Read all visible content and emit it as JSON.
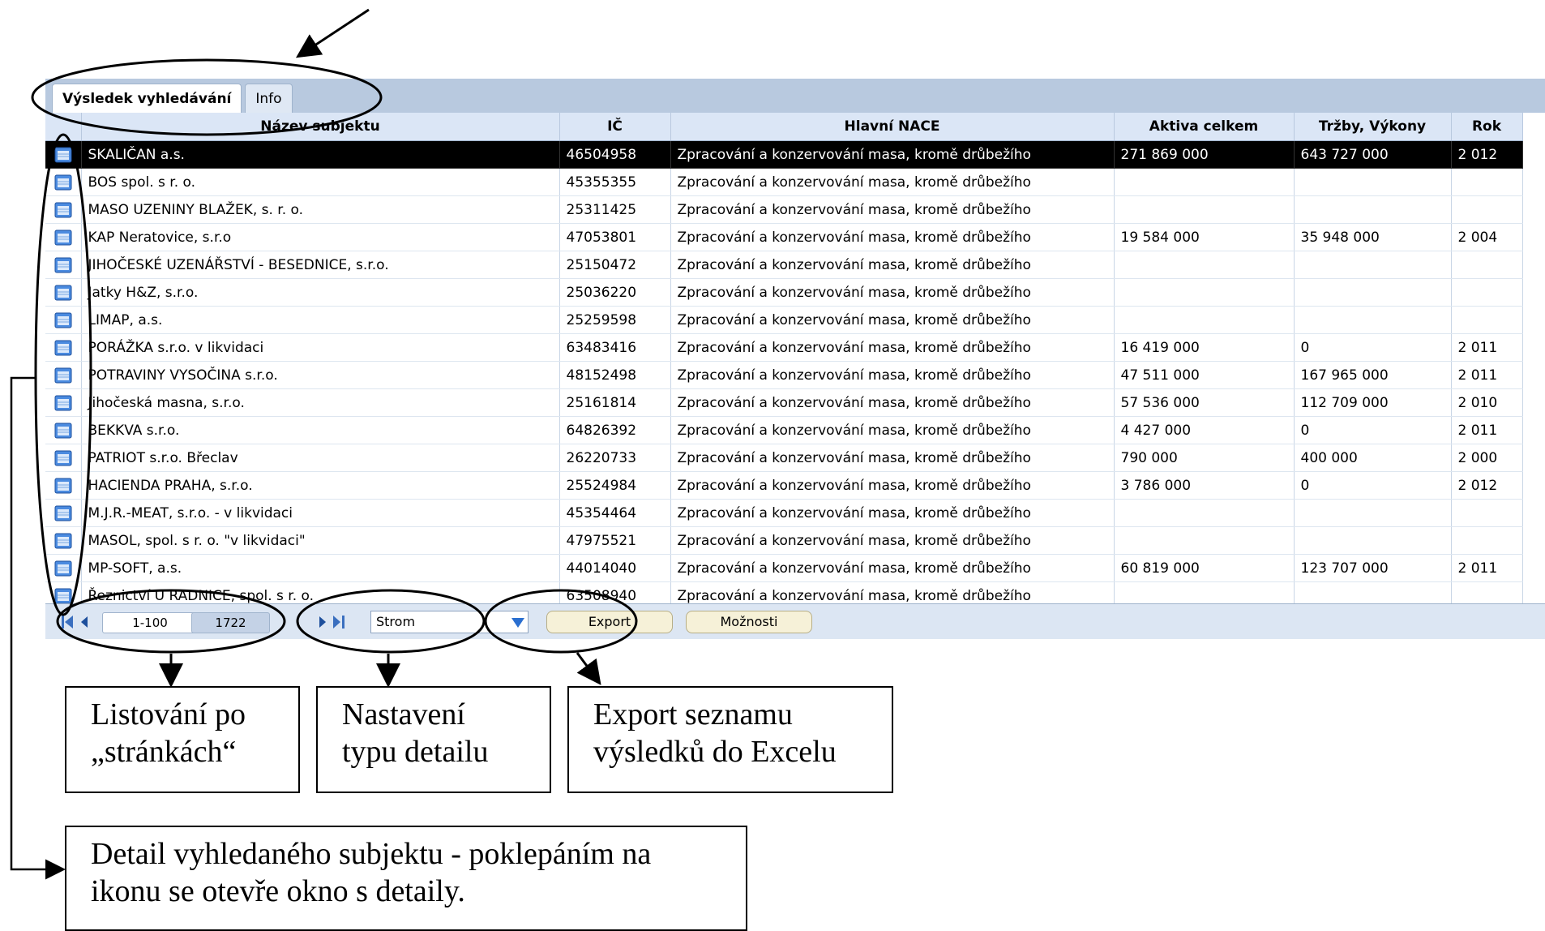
{
  "tabs": [
    "Výsledek vyhledávání",
    "Info"
  ],
  "columns": {
    "name": "Název subjektu",
    "ic": "IČ",
    "nace": "Hlavní NACE",
    "aktiva": "Aktiva celkem",
    "trzby": "Tržby, Výkony",
    "rok": "Rok"
  },
  "rows": [
    {
      "name": "SKALIČAN a.s.",
      "ic": "46504958",
      "nace": "Zpracování a konzervování masa, kromě drůbežího",
      "aktiva": "271 869 000",
      "trzby": "643 727 000",
      "rok": "2 012"
    },
    {
      "name": "BOS spol. s r. o.",
      "ic": "45355355",
      "nace": "Zpracování a konzervování masa, kromě drůbežího",
      "aktiva": "",
      "trzby": "",
      "rok": ""
    },
    {
      "name": "MASO UZENINY BLAŽEK, s. r. o.",
      "ic": "25311425",
      "nace": "Zpracování a konzervování masa, kromě drůbežího",
      "aktiva": "",
      "trzby": "",
      "rok": ""
    },
    {
      "name": "KAP Neratovice, s.r.o",
      "ic": "47053801",
      "nace": "Zpracování a konzervování masa, kromě drůbežího",
      "aktiva": "19 584 000",
      "trzby": "35 948 000",
      "rok": "2 004"
    },
    {
      "name": "JIHOČESKÉ UZENÁŘSTVÍ - BESEDNICE, s.r.o.",
      "ic": "25150472",
      "nace": "Zpracování a konzervování masa, kromě drůbežího",
      "aktiva": "",
      "trzby": "",
      "rok": ""
    },
    {
      "name": "Jatky H&Z, s.r.o.",
      "ic": "25036220",
      "nace": "Zpracování a konzervování masa, kromě drůbežího",
      "aktiva": "",
      "trzby": "",
      "rok": ""
    },
    {
      "name": "LIMAP, a.s.",
      "ic": "25259598",
      "nace": "Zpracování a konzervování masa, kromě drůbežího",
      "aktiva": "",
      "trzby": "",
      "rok": ""
    },
    {
      "name": "PORÁŽKA s.r.o. v likvidaci",
      "ic": "63483416",
      "nace": "Zpracování a konzervování masa, kromě drůbežího",
      "aktiva": "16 419 000",
      "trzby": "0",
      "rok": "2 011"
    },
    {
      "name": "POTRAVINY VYSOČINA s.r.o.",
      "ic": "48152498",
      "nace": "Zpracování a konzervování masa, kromě drůbežího",
      "aktiva": "47 511 000",
      "trzby": "167 965 000",
      "rok": "2 011"
    },
    {
      "name": "Jihočeská masna, s.r.o.",
      "ic": "25161814",
      "nace": "Zpracování a konzervování masa, kromě drůbežího",
      "aktiva": "57 536 000",
      "trzby": "112 709 000",
      "rok": "2 010"
    },
    {
      "name": "BEKKVA s.r.o.",
      "ic": "64826392",
      "nace": "Zpracování a konzervování masa, kromě drůbežího",
      "aktiva": "4 427 000",
      "trzby": "0",
      "rok": "2 011"
    },
    {
      "name": "PATRIOT s.r.o. Břeclav",
      "ic": "26220733",
      "nace": "Zpracování a konzervování masa, kromě drůbežího",
      "aktiva": "790 000",
      "trzby": "400 000",
      "rok": "2 000"
    },
    {
      "name": "HACIENDA PRAHA, s.r.o.",
      "ic": "25524984",
      "nace": "Zpracování a konzervování masa, kromě drůbežího",
      "aktiva": "3 786 000",
      "trzby": "0",
      "rok": "2 012"
    },
    {
      "name": "M.J.R.-MEAT, s.r.o. - v likvidaci",
      "ic": "45354464",
      "nace": "Zpracování a konzervování masa, kromě drůbežího",
      "aktiva": "",
      "trzby": "",
      "rok": ""
    },
    {
      "name": "MASOL, spol. s r. o. \"v likvidaci\"",
      "ic": "47975521",
      "nace": "Zpracování a konzervování masa, kromě drůbežího",
      "aktiva": "",
      "trzby": "",
      "rok": ""
    },
    {
      "name": "MP-SOFT, a.s.",
      "ic": "44014040",
      "nace": "Zpracování a konzervování masa, kromě drůbežího",
      "aktiva": "60 819 000",
      "trzby": "123 707 000",
      "rok": "2 011"
    },
    {
      "name": "Řeznictví U RADNICE, spol. s r. o.",
      "ic": "63508940",
      "nace": "Zpracování a konzervování masa, kromě drůbežího",
      "aktiva": "",
      "trzby": "",
      "rok": ""
    }
  ],
  "pager": {
    "range": "1-100",
    "total": "1722"
  },
  "detail_select": "Strom",
  "buttons": {
    "export": "Export",
    "options": "Možnosti"
  },
  "annotations": {
    "paging": [
      "Listování po",
      "„stránkách“"
    ],
    "detail_type": [
      "Nastavení",
      "typu detailu"
    ],
    "export": [
      "Export seznamu",
      "výsledků do Excelu"
    ],
    "detail": [
      "Detail vyhledaného subjektu - poklepáním na",
      "ikonu se otevře okno s detaily."
    ]
  },
  "colors": {
    "header_bg": "#dbe6f6",
    "panel_bg": "#b8c9df",
    "selected_row": "#000000",
    "button_bg": "#f6f1d8",
    "icon_blue": "#3b7fd1"
  }
}
